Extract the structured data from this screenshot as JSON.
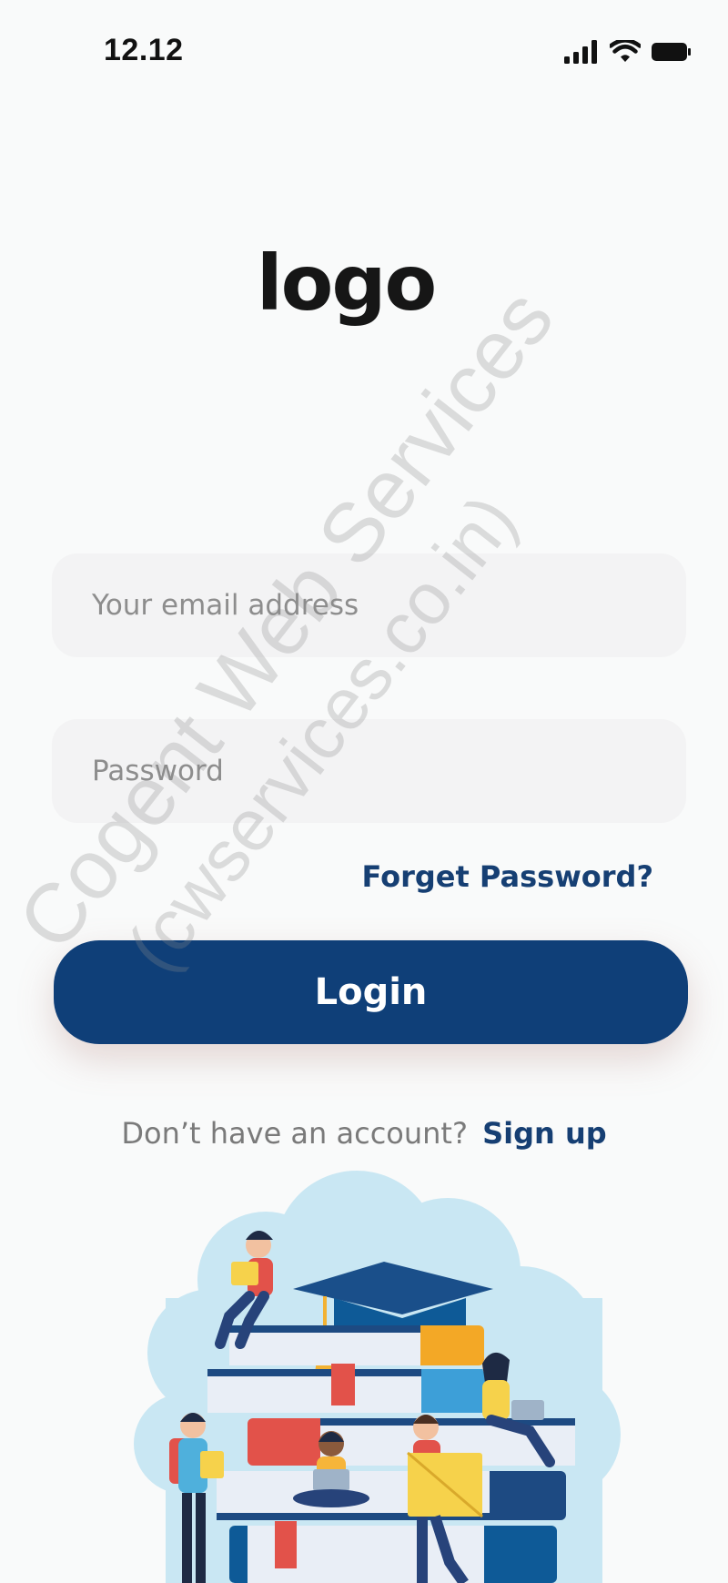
{
  "status_bar": {
    "time": "12.12",
    "icons": [
      "signal-icon",
      "wifi-icon",
      "battery-icon"
    ]
  },
  "logo": {
    "text": "logo"
  },
  "form": {
    "email_placeholder": "Your email address",
    "email_value": "",
    "password_placeholder": "Password",
    "password_value": "",
    "forget_password_label": "Forget Password?",
    "login_label": "Login"
  },
  "signup": {
    "prompt": "Don’t have an account?",
    "link_label": "Sign up"
  },
  "watermark": {
    "line1": "Cogent Web Services",
    "line2": "(cwservices.co.in)"
  },
  "colors": {
    "primary": "#0f3f78",
    "link": "#163f73",
    "field_bg": "#f3f3f4",
    "background": "#f9fafa"
  }
}
